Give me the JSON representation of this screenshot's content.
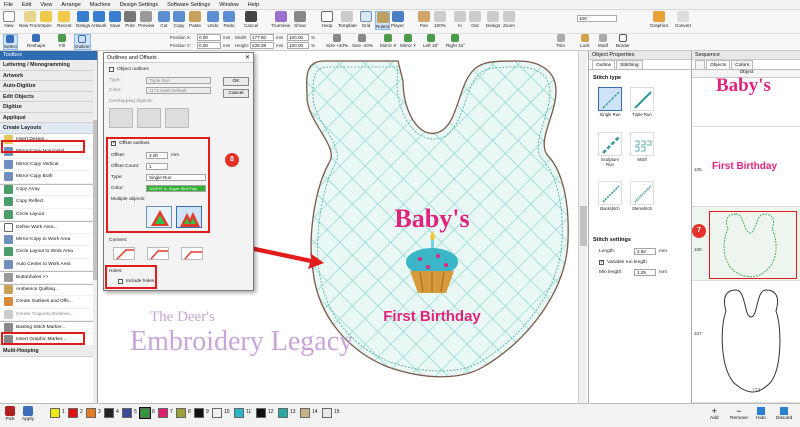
{
  "menubar": [
    "File",
    "Edit",
    "View",
    "Arrange",
    "Machine",
    "Design Settings",
    "Software Settings",
    "Window",
    "Help"
  ],
  "ribbon": {
    "row1": [
      "New",
      "New From",
      "Open",
      "Recent",
      "Design",
      "Artwork",
      "Save",
      "Print",
      "Preview",
      "Cut",
      "Copy",
      "Paste",
      "Undo",
      "Redo",
      "Cancel",
      "TrueView",
      "Show",
      "Hoop",
      "Template",
      "Grid",
      "Rulers",
      "Player",
      "Pan",
      "100%",
      "In",
      "Out",
      "Design",
      "Zoom",
      "Graphics",
      "Convert"
    ],
    "zoom_value": "100",
    "row2": [
      "Select",
      "Reshape",
      "Fill",
      "Outline",
      "Mirror X",
      "Mirror Y",
      "Left 15°",
      "Right 15°",
      "Size +10%",
      "Size -10%",
      "Trim",
      "Lock",
      "Motif",
      "Border"
    ],
    "position_x_label": "Position X:",
    "position_x": "0.00",
    "position_y_label": "Position Y:",
    "position_y": "0.00",
    "width_label": "Width:",
    "width": "177.80",
    "height_label": "Height:",
    "height": "239.39",
    "w_pct": "100.00",
    "h_pct": "100.00",
    "unit": "mm",
    "pct": "%"
  },
  "toolbox": {
    "title": "Toolbox",
    "categories_top": [
      "Lettering / Monogramming",
      "Artwork",
      "Auto-Digitize",
      "Edit Objects",
      "Digitize",
      "Appliqué"
    ],
    "open_category": "Create Layouts",
    "items": [
      "Insert Design...",
      "Mirror-Copy Horizontal",
      "Mirror-Copy Vertical",
      "Mirror-Copy Both",
      "Copy Array",
      "Copy Reflect",
      "Circle Layout",
      "Define Work Area...",
      "Mirror-Copy to Work Area",
      "Circle Layout to Work Area",
      "Auto Center to Work Area",
      "Buttonholes >>",
      "Ambience Quilting...",
      "Create Outlines and Offs...",
      "Create Trapunto Outlines...",
      "Basting Stitch Marker...",
      "Insert Graphic Marker..."
    ],
    "category_bottom": "Multi-Hooping"
  },
  "dialog": {
    "title": "Outlines and Offsets",
    "close": "✕",
    "object_outlines": "Object outlines",
    "type_label": "Type:",
    "type_value": "Triple Run",
    "color_label": "Color:",
    "color_value": "1172 Heidi Default",
    "overlapping": "Overlapping objects:",
    "offset_outlines": "Offset outlines",
    "offset_label": "Offset:",
    "offset_value": "3.00",
    "offset_unit": "mm",
    "count_label": "Offset Count:",
    "count_value": "1",
    "type2_label": "Type:",
    "type2_value": "Single Run",
    "color2_label": "Color:",
    "color2_value": "1049 R. A. Super Strd Poly",
    "multiple": "Multiple objects:",
    "corners": "Corners:",
    "holes": "Holes:",
    "include_holes": "Include holes",
    "ok": "OK",
    "cancel": "Cancel",
    "badge": "8"
  },
  "canvas": {
    "babys": "Baby's",
    "first_birthday": "First Birthday",
    "watermark_line1": "The Deer's",
    "watermark_line2": "Embroidery Legacy",
    "colors": {
      "bib_outline": "#7a5a4a",
      "grid": "#7fd3c7",
      "pink": "#e0237c"
    }
  },
  "properties": {
    "title": "Object Properties",
    "tabs": [
      "Outline",
      "Stitching"
    ],
    "stitch_type": "Stitch type",
    "stitches": [
      "Single Run",
      "Triple Run",
      "Sculpture Run",
      "Motif",
      "Backstitch",
      "Stemstitch"
    ],
    "stitch_settings": "Stitch settings",
    "length_label": "Length:",
    "length_value": "2.50",
    "variable_run": "Variable run length",
    "min_length_label": "Min length:",
    "min_length_value": "1.25",
    "unit": "mm"
  },
  "sequence": {
    "title": "Sequence",
    "tabs": [
      "Objects",
      "Colors"
    ],
    "column": "Object",
    "rows": [
      {
        "num": "",
        "label": "Baby's"
      },
      {
        "num": "105",
        "label": "First Birthday"
      },
      {
        "num": "106",
        "label": ""
      },
      {
        "num": "107",
        "label": ""
      }
    ],
    "badge": "7",
    "footer_count": "123"
  },
  "bottom": {
    "pick": "Pick",
    "apply": "Apply",
    "swatches": [
      "1",
      "2",
      "3",
      "4",
      "5",
      "6",
      "7",
      "8",
      "9",
      "10",
      "11",
      "12",
      "13",
      "14",
      "15"
    ],
    "swatch_colors": [
      "#e9e90f",
      "#d11",
      "#e87a1f",
      "#222",
      "#3a4a9a",
      "#2a9a3a",
      "#e02070",
      "#9aa23a",
      "#111111",
      "#f0f0f0",
      "#29b4c8",
      "#111111",
      "#2aa9a0",
      "#c8b08a",
      "#e8e8e8"
    ],
    "actions": [
      "Add",
      "Remove",
      "Hide",
      "Discard"
    ]
  }
}
